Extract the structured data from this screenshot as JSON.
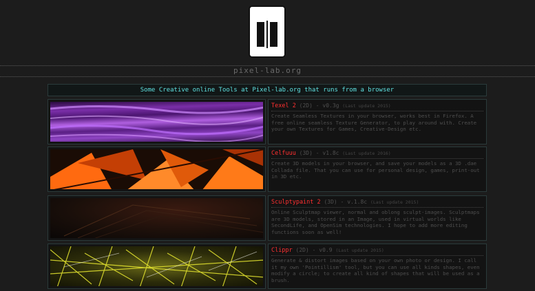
{
  "site": {
    "name": "pixel-lab.org"
  },
  "header": {
    "text": "Some Creative online Tools at Pixel-lab.org that runs from a browser"
  },
  "tools": [
    {
      "name": "Texel 2",
      "version": "(2D) - v0.3g",
      "updated": "(Last update 2015)",
      "description": "Create Seamless Textures in your browser, works best in Firefox. A free online seamless Texture Generator, to play around with. Create your own Textures for Games, Creative-Design etc.",
      "thumbnail_icon": "texel-seamless-texture-thumbnail"
    },
    {
      "name": "Celfuuu",
      "version": "(3D) - v1.8c",
      "updated": "(Last update 2016)",
      "description": "Create 3D models in your browser, and save your models as a 3D .dae Collada file. That you can use for personal design, games, print-out in 3D etc.",
      "thumbnail_icon": "celfuuu-3d-model-thumbnail"
    },
    {
      "name": "Sculptypaint 2",
      "version": "(3D) - v.1.8c",
      "updated": "(Last update 2015)",
      "description": "Online Sculptmap viewer, normal and oblong sculpt-images. Sculptmaps are 3D models, stored in an Image, used in virtual worlds like SecondLife, and OpenSim technologies. I hope to add more editing functions soon as well!",
      "thumbnail_icon": "sculptmap-thumbnail"
    },
    {
      "name": "Clippr",
      "version": "(2D) - v0.9",
      "updated": "(Last update 2015)",
      "description": "Generate & distort images based on your own photo or design. I call it my own 'Pointillism' tool, but you can use all kinds shapes, even modify a circle; to create all kind of shapes that will be used as a brush.",
      "thumbnail_icon": "clippr-pointillism-thumbnail"
    }
  ],
  "colors": {
    "background": "#1c1c1c",
    "header_text": "#5fe0e0",
    "tool_name": "#ff3030",
    "body_text": "#4e4e4e"
  }
}
